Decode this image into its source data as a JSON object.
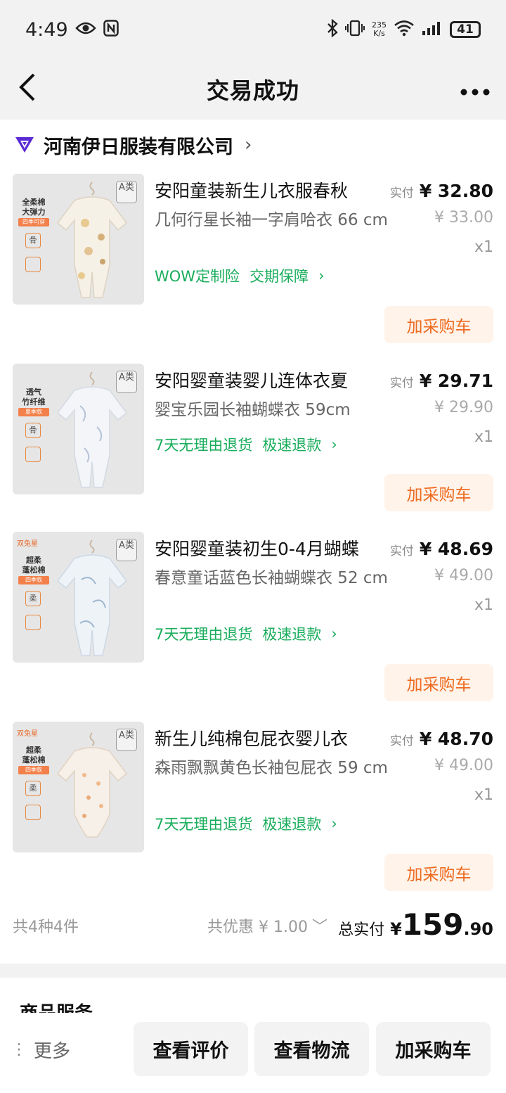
{
  "status_bar": {
    "time": "4:49",
    "net_speed_value": "235",
    "net_speed_unit": "K/s",
    "battery": "41"
  },
  "nav": {
    "back_glyph": "‹",
    "title": "交易成功",
    "more_glyph": "•••"
  },
  "shop": {
    "name": "河南伊日服装有限公司",
    "chevron": "›"
  },
  "items": [
    {
      "title": "安阳童装新生儿衣服春秋",
      "spec": "几何行星长袖一字肩哈衣 66 cm",
      "service_1": "WOW定制险",
      "service_2": "交期保障",
      "service_chevron": "›",
      "paid_label": "实付",
      "paid_price": "¥ 32.80",
      "original_price": "¥ 33.00",
      "quantity": "x1",
      "add_cart": "加采购车",
      "thumb": {
        "line1": "全柔棉",
        "line2": "大弹力",
        "tag": "四季可穿",
        "badge": "A类",
        "icon": "骨",
        "brand": ""
      }
    },
    {
      "title": "安阳婴童装婴儿连体衣夏",
      "spec": "婴宝乐园长袖蝴蝶衣 59cm",
      "service_1": "7天无理由退货",
      "service_2": "极速退款",
      "service_chevron": "›",
      "paid_label": "实付",
      "paid_price": "¥ 29.71",
      "original_price": "¥ 29.90",
      "quantity": "x1",
      "add_cart": "加采购车",
      "thumb": {
        "line1": "透气",
        "line2": "竹纤维",
        "tag": "夏季款",
        "badge": "A类",
        "icon": "骨",
        "brand": ""
      }
    },
    {
      "title": "安阳婴童装初生0-4月蝴蝶",
      "spec": "春意童话蓝色长袖蝴蝶衣 52 cm",
      "service_1": "7天无理由退货",
      "service_2": "极速退款",
      "service_chevron": "›",
      "paid_label": "实付",
      "paid_price": "¥ 48.69",
      "original_price": "¥ 49.00",
      "quantity": "x1",
      "add_cart": "加采购车",
      "thumb": {
        "line1": "超柔",
        "line2": "蓬松棉",
        "tag": "四季款",
        "badge": "A类",
        "icon": "柔",
        "brand": "双兔星"
      }
    },
    {
      "title": "新生儿纯棉包屁衣婴儿衣",
      "spec": "森雨飘飘黄色长袖包屁衣 59 cm",
      "service_1": "7天无理由退货",
      "service_2": "极速退款",
      "service_chevron": "›",
      "paid_label": "实付",
      "paid_price": "¥ 48.70",
      "original_price": "¥ 49.00",
      "quantity": "x1",
      "add_cart": "加采购车",
      "thumb": {
        "line1": "超柔",
        "line2": "蓬松棉",
        "tag": "四季款",
        "badge": "A类",
        "icon": "柔",
        "brand": "双兔星"
      }
    }
  ],
  "summary": {
    "count": "共4种4件",
    "discount": "共优惠 ¥ 1.00",
    "discount_chevron": "﹀",
    "total_label": "总实付",
    "total_yen": "¥",
    "total_int": "159",
    "total_dec": ".90"
  },
  "section2": {
    "title": "商品服务"
  },
  "bottom_bar": {
    "more_dots": "⋮",
    "more_label": "更多",
    "review": "查看评价",
    "logistics": "查看物流",
    "add_cart": "加采购车"
  },
  "colors": {
    "accent_orange": "#ee6a1e",
    "service_green": "#1aad5c",
    "shop_logo_purple": "#5b2bd6"
  }
}
